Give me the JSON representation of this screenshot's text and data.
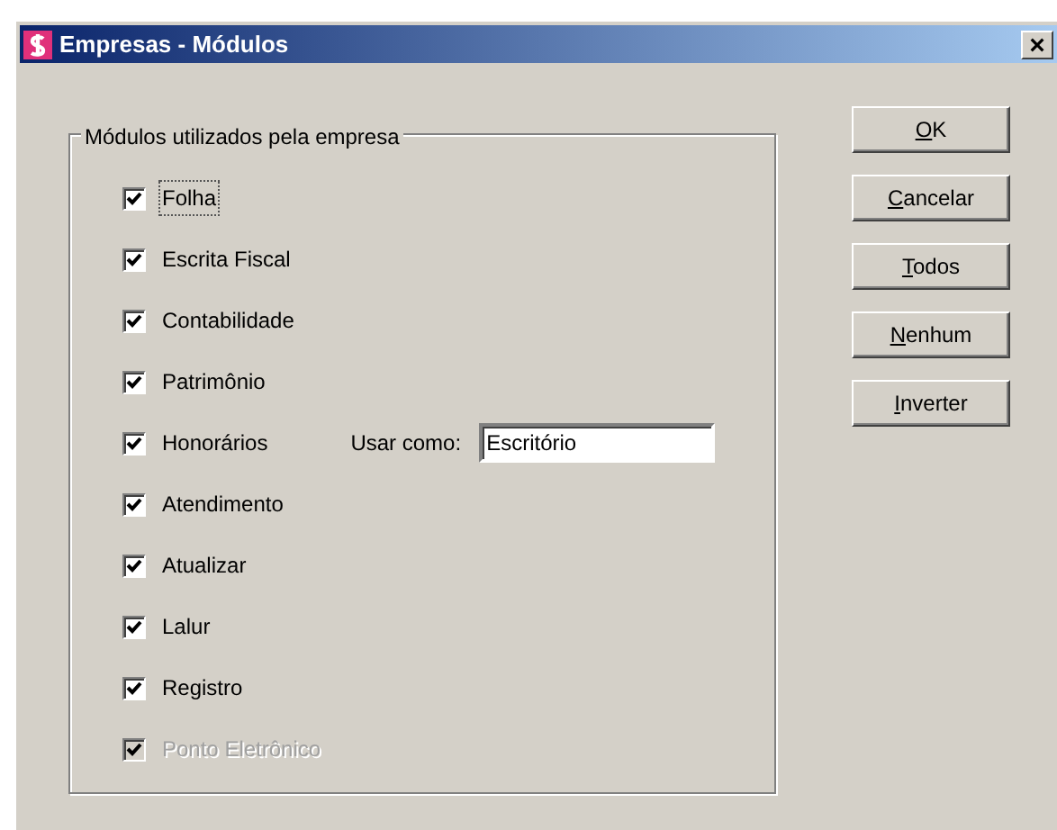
{
  "window": {
    "title": "Empresas - Módulos",
    "close": "×"
  },
  "group": {
    "title": "Módulos utilizados pela empresa",
    "modules": [
      {
        "label": "Folha",
        "checked": true,
        "disabled": false,
        "focused": true
      },
      {
        "label": "Escrita Fiscal",
        "checked": true,
        "disabled": false,
        "focused": false
      },
      {
        "label": "Contabilidade",
        "checked": true,
        "disabled": false,
        "focused": false
      },
      {
        "label": "Patrimônio",
        "checked": true,
        "disabled": false,
        "focused": false
      },
      {
        "label": "Honorários",
        "checked": true,
        "disabled": false,
        "focused": false,
        "field": {
          "label": "Usar como:",
          "value": "Escritório"
        }
      },
      {
        "label": "Atendimento",
        "checked": true,
        "disabled": false,
        "focused": false
      },
      {
        "label": "Atualizar",
        "checked": true,
        "disabled": false,
        "focused": false
      },
      {
        "label": "Lalur",
        "checked": true,
        "disabled": false,
        "focused": false
      },
      {
        "label": "Registro",
        "checked": true,
        "disabled": false,
        "focused": false
      },
      {
        "label": "Ponto Eletrônico",
        "checked": true,
        "disabled": true,
        "focused": false
      }
    ]
  },
  "buttons": [
    {
      "parts": [
        {
          "text": "O",
          "underlined": true
        },
        {
          "text": "K",
          "underlined": false
        }
      ]
    },
    {
      "parts": [
        {
          "text": "C",
          "underlined": true
        },
        {
          "text": "ancelar",
          "underlined": false
        }
      ]
    },
    {
      "parts": [
        {
          "text": "T",
          "underlined": true
        },
        {
          "text": "odos",
          "underlined": false
        }
      ]
    },
    {
      "parts": [
        {
          "text": "N",
          "underlined": true
        },
        {
          "text": "enhum",
          "underlined": false
        }
      ]
    },
    {
      "parts": [
        {
          "text": "I",
          "underlined": true
        },
        {
          "text": "nverter",
          "underlined": false
        }
      ]
    }
  ]
}
